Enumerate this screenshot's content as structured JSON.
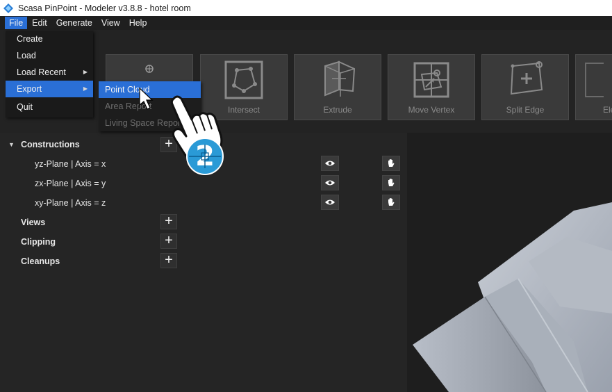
{
  "window": {
    "title": "Scasa PinPoint - Modeler v3.8.8 - hotel room"
  },
  "menubar": {
    "items": [
      "File",
      "Edit",
      "Generate",
      "View",
      "Help"
    ]
  },
  "toolbar": {
    "tools": [
      {
        "label": "",
        "icon": "point-icon"
      },
      {
        "label": "Intersect",
        "icon": "intersect-icon"
      },
      {
        "label": "Extrude",
        "icon": "extrude-icon"
      },
      {
        "label": "Move Vertex",
        "icon": "move-vertex-icon"
      },
      {
        "label": "Split Edge",
        "icon": "split-edge-icon"
      },
      {
        "label": "Ele",
        "icon": "element-icon"
      }
    ]
  },
  "file_menu": {
    "items": [
      "Create",
      "Load",
      "Load Recent",
      "Export",
      "Quit"
    ]
  },
  "export_submenu": {
    "items": [
      "Point Cloud",
      "Area Report",
      "Living Space Report"
    ]
  },
  "tree": {
    "constructions": "Constructions",
    "planes": [
      "yz-Plane | Axis = x",
      "zx-Plane | Axis = y",
      "xy-Plane | Axis = z"
    ],
    "views": "Views",
    "clipping": "Clipping",
    "cleanups": "Cleanups"
  },
  "tutorial": {
    "step_number": "2"
  },
  "colors": {
    "accent": "#2a6fd6",
    "cursor_badge": "#2a9ad6"
  }
}
